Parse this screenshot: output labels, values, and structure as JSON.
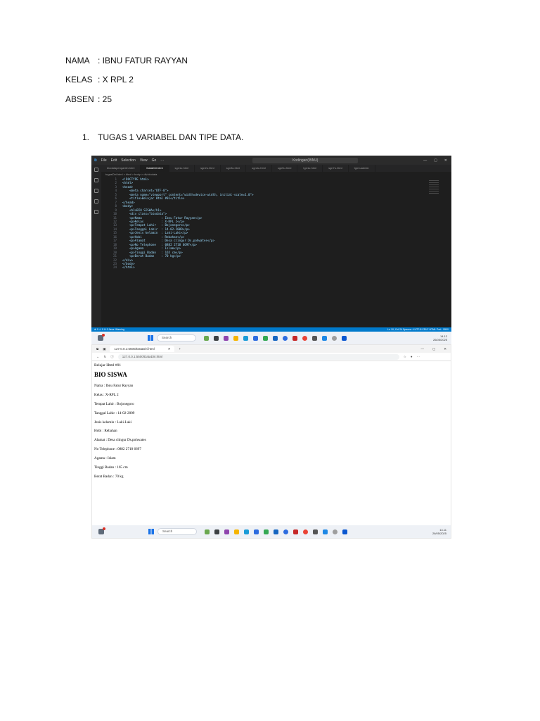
{
  "header": {
    "nama_label": "NAMA",
    "nama_value": ": IBNU FATUR RAYYAN",
    "kelas_label": "KELAS",
    "kelas_value": ": X RPL 2",
    "absen_label": "ABSEN",
    "absen_value": ": 25"
  },
  "task": {
    "number": "1.",
    "title": "TUGAS 1 VARIABEL DAN TIPE DATA."
  },
  "vscode": {
    "menu": [
      "File",
      "Edit",
      "Selection",
      "View",
      "Go",
      "···"
    ],
    "command_center": "Kodingan(IBNU)",
    "tabs": [
      "biodatapengantin.html",
      "DataDiri.html",
      "sgn1u.html",
      "sgn2u.html",
      "sgn3u.html",
      "sgn4u.html",
      "sgn5u.html",
      "tgn1u.html",
      "sgn7u.html",
      "tgn1uadmin"
    ],
    "active_tab_index": 1,
    "breadcrumb": "tugasDiri.html > html > body > div.biodata",
    "code_lines": [
      {
        "n": "1",
        "code": "<!DOCTYPE html>"
      },
      {
        "n": "2",
        "code": "<html>"
      },
      {
        "n": "3",
        "code": "<head>"
      },
      {
        "n": "4",
        "code": "    <meta charset=\"UTF-8\">"
      },
      {
        "n": "5",
        "code": "    <meta name=\"viewport\" content=\"width=device-width, initial-scale=1.0\">"
      },
      {
        "n": "6",
        "code": "    <title>Belajar Html #01</title>"
      },
      {
        "n": "7",
        "code": "</head>"
      },
      {
        "n": "8",
        "code": "<body>"
      },
      {
        "n": "9",
        "code": "    <h1>BIO SISWA</h1>"
      },
      {
        "n": "10",
        "code": "    <div class=\"biodata\">"
      },
      {
        "n": "11",
        "code": "    <p>Nama           : Ibnu Fatur Rayyan</p>"
      },
      {
        "n": "12",
        "code": "    <p>Kelas          : X-RPL 2</p>"
      },
      {
        "n": "13",
        "code": "    <p>Tempat Lahir   : Bojonegoro</p>"
      },
      {
        "n": "14",
        "code": "    <p>Tanggal Lahir  : 14-02-2009</p>"
      },
      {
        "n": "15",
        "code": "    <p>Jenis kelamin  : Laki-Laki</p>"
      },
      {
        "n": "16",
        "code": "    <p>Hobi           : Rebahan</p>"
      },
      {
        "n": "17",
        "code": "    <p>Alamat         : Desa clingur Ds.pohwates</p>"
      },
      {
        "n": "18",
        "code": "    <p>No Telephone   : 0882 2718 6697</p>"
      },
      {
        "n": "19",
        "code": "    <p>Agama          : Islam</p>"
      },
      {
        "n": "20",
        "code": "    <p>Tinggi Badan   : 165 cm</p>"
      },
      {
        "n": "21",
        "code": "    <p>Berat Badan    : 70 kg</p>"
      },
      {
        "n": "22",
        "code": "</div>"
      },
      {
        "n": "23",
        "code": "</body>"
      },
      {
        "n": "24",
        "code": "</html>"
      }
    ],
    "status_left": "⊗ 0 ⚠ 0    ⟳ 0    Java: Warning",
    "status_right": "Ln 10, Col 24   Spaces: 4   UTF-8   CRLF   HTML   Port : 5500"
  },
  "taskbar1": {
    "search_label": "Search",
    "time": "14.12",
    "date": "26/05/2025"
  },
  "browser": {
    "tab_title": "127.0.0.1:5500/DataDiri.html",
    "url": "127.0.0.1:5500/DataDiri.html",
    "page_title": "Belajar Html #01",
    "heading": "BIO SISWA",
    "rows": [
      "Nama : Ibnu Fatur Rayyan",
      "Kelas : X-RPL 2",
      "Tempat Lahir : Bojonegoro",
      "Tanggal Lahir : 14-02-2009",
      "Jenis kelamin : Laki-Laki",
      "Hobi : Rebahan",
      "Alamat : Desa clingur Ds.pohwates",
      "No Telephone : 0882 2718 6697",
      "Agama : Islam",
      "Tinggi Badan : 165 cm",
      "Berat Badan : 70 kg"
    ]
  },
  "taskbar2": {
    "search_label": "Search",
    "time": "14.11",
    "date": "26/05/2025"
  },
  "colors": {
    "vscode_bg": "#1e1e1e",
    "vscode_status": "#007acc",
    "taskbar_bg": "#eef1f6",
    "windows_accent": "#1a73e8"
  }
}
